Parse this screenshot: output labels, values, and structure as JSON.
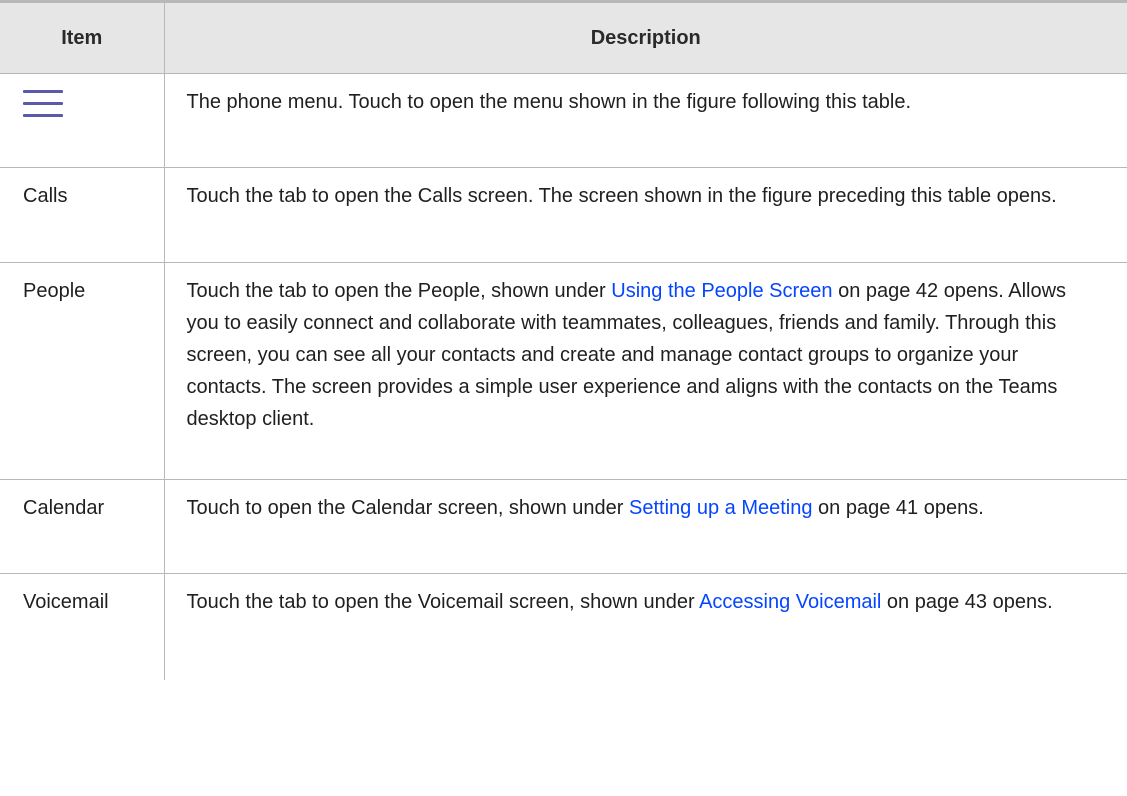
{
  "table": {
    "headers": {
      "item": "Item",
      "description": "Description"
    },
    "icon_color": "#5a5aa8",
    "link_color": "#0645ff",
    "rows": {
      "menu": {
        "item_icon": "hamburger-menu-icon",
        "description": "The phone menu. Touch to open the menu shown in the figure following this table."
      },
      "calls": {
        "item": "Calls",
        "description": "Touch the tab to open the Calls screen. The screen shown in the figure preceding this table opens."
      },
      "people": {
        "item": "People",
        "desc_before": "Touch the tab to open the People, shown under ",
        "link": "Using the People Screen",
        "desc_after": " on page 42 opens. Allows you to easily connect and collaborate with teammates, colleagues, friends and family. Through this screen, you can see all your contacts and create and manage contact groups to organize your contacts. The screen provides a simple user experience and aligns with the contacts on the Teams desktop client."
      },
      "calendar": {
        "item": "Calendar",
        "desc_before": "Touch to open the Calendar screen, shown under ",
        "link": "Setting up a Meeting",
        "desc_after": " on page 41 opens."
      },
      "voicemail": {
        "item": "Voicemail",
        "desc_before": "Touch the tab to open the Voicemail screen, shown under ",
        "link": "Accessing Voicemail",
        "desc_after": " on page 43 opens."
      }
    }
  }
}
